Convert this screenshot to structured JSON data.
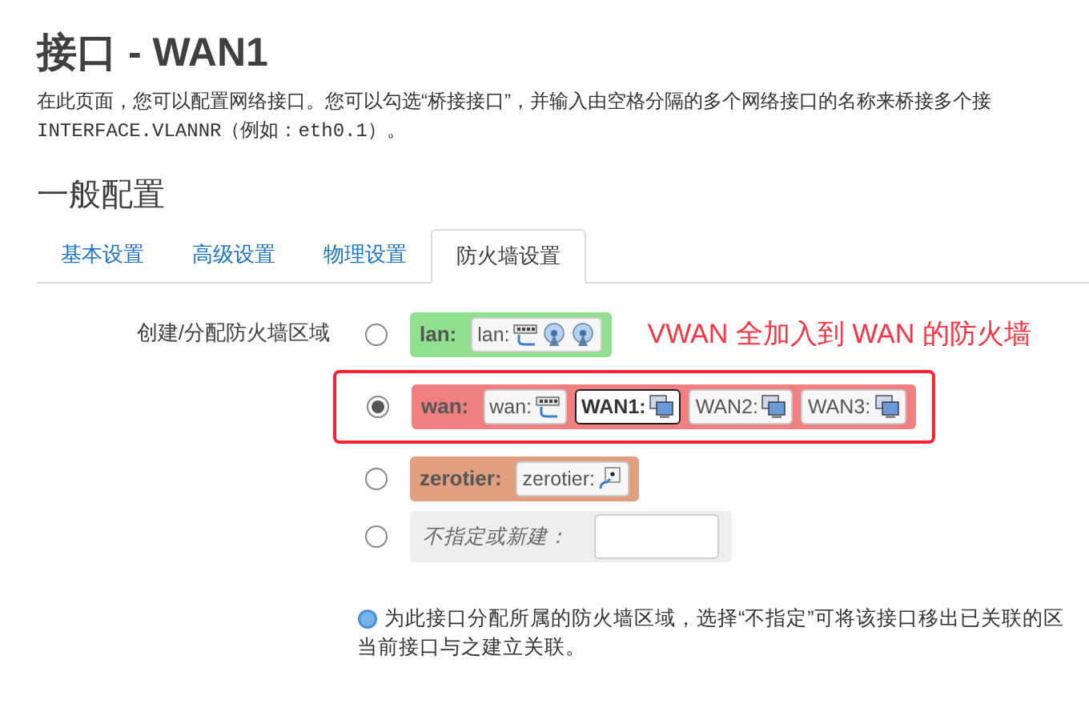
{
  "title": "接口 - WAN1",
  "description": [
    [
      {
        "text": "在此页面，您可以配置网络接口。您可以勾选“桥接接口”，并输入由空格分隔的多个网络接口的名称来桥接多个接",
        "code": false
      }
    ],
    [
      {
        "text": "INTERFACE.VLANNR",
        "code": true
      },
      {
        "text": "（例如：",
        "code": false
      },
      {
        "text": "eth0.1",
        "code": true
      },
      {
        "text": "）。",
        "code": false
      }
    ]
  ],
  "section_title": "一般配置",
  "tabs": [
    {
      "label": "基本设置",
      "selected": false
    },
    {
      "label": "高级设置",
      "selected": false
    },
    {
      "label": "物理设置",
      "selected": false
    },
    {
      "label": "防火墙设置",
      "selected": true
    }
  ],
  "field_label": "创建/分配防火墙区域",
  "annotation": "VWAN 全加入到 WAN 的防火墙",
  "zones": [
    {
      "kind": "zone",
      "name": "lan:",
      "color": "#90e090",
      "selected": false,
      "highlighted": false,
      "networks": [
        {
          "name": "lan:",
          "current": false,
          "icons": [
            {
              "kind": "switch"
            },
            {
              "kind": "wireless"
            },
            {
              "kind": "wireless"
            }
          ]
        }
      ]
    },
    {
      "kind": "zone",
      "name": "wan:",
      "color": "#f08080",
      "selected": true,
      "highlighted": true,
      "networks": [
        {
          "name": "wan:",
          "current": false,
          "icons": [
            {
              "kind": "switch"
            }
          ]
        },
        {
          "name": "WAN1:",
          "current": true,
          "icons": [
            {
              "kind": "monitor"
            }
          ]
        },
        {
          "name": "WAN2:",
          "current": false,
          "icons": [
            {
              "kind": "monitor"
            }
          ]
        },
        {
          "name": "WAN3:",
          "current": false,
          "icons": [
            {
              "kind": "monitor"
            }
          ]
        }
      ]
    },
    {
      "kind": "zone",
      "name": "zerotier:",
      "color": "#e0a080",
      "selected": false,
      "highlighted": false,
      "networks": [
        {
          "name": "zerotier:",
          "current": false,
          "icons": [
            {
              "kind": "tunnel"
            }
          ]
        }
      ]
    },
    {
      "kind": "new",
      "name": "不指定或新建：",
      "selected": false,
      "highlighted": false
    }
  ],
  "help": [
    "为此接口分配所属的防火墙区域，选择“不指定”可将该接口移出已关联的区",
    "当前接口与之建立关联。"
  ]
}
